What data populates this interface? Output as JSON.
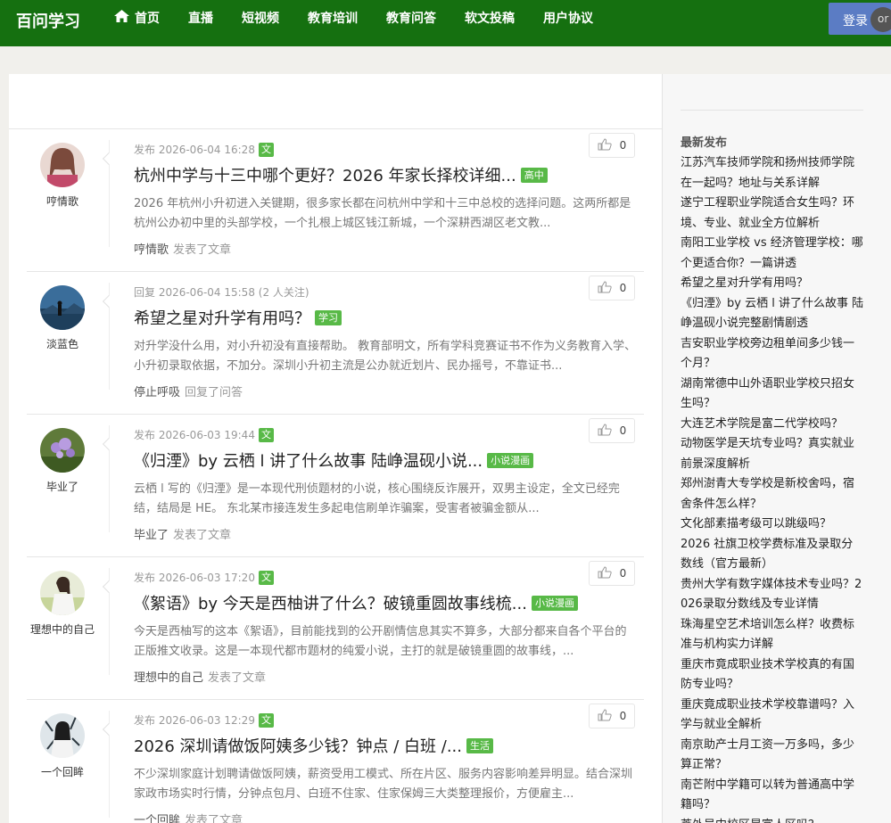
{
  "brand": "百问学习",
  "nav": {
    "items": [
      "首页",
      "直播",
      "短视频",
      "教育培训",
      "教育问答",
      "软文投稿",
      "用户协议"
    ],
    "login_label": "登录",
    "extra_label": "or"
  },
  "feed": [
    {
      "author": "哼情歌",
      "meta_label": "发布 2026-06-04 16:28",
      "type_badge": "文",
      "likes": "0",
      "title": "杭州中学与十三中哪个更好？2026 年家长择校详细...",
      "tag": "高中",
      "excerpt": "2026 年杭州小升初进入关键期，很多家长都在问杭州中学和十三中总校的选择问题。这两所都是杭州公办初中里的头部学校，一个扎根上城区钱江新城，一个深耕西湖区老文教...",
      "action_user": "哼情歌",
      "action_verb": "发表了文章"
    },
    {
      "author": "淡蓝色",
      "meta_label": "回复 2026-06-04 15:58 (2 人关注)",
      "type_badge": "",
      "likes": "0",
      "title": "希望之星对升学有用吗？",
      "tag": "学习",
      "excerpt": "对升学没什么用，对小升初没有直接帮助。 教育部明文，所有学科竞赛证书不作为义务教育入学、小升初录取依据，不加分。深圳小升初主流是公办就近划片、民办摇号，不靠证书...",
      "action_user": "停止呼吸",
      "action_verb": "回复了问答"
    },
    {
      "author": "毕业了",
      "meta_label": "发布 2026-06-03 19:44",
      "type_badge": "文",
      "likes": "0",
      "title": "《归湮》by 云栖 l 讲了什么故事 陆峥温砚小说...",
      "tag": "小说漫画",
      "excerpt": "云栖 l 写的《归湮》是一本现代刑侦题材的小说，核心围绕反诈展开，双男主设定，全文已经完结，结局是 HE。 东北某市接连发生多起电信刷单诈骗案，受害者被骗金额从...",
      "action_user": "毕业了",
      "action_verb": "发表了文章"
    },
    {
      "author": "理想中的自己",
      "meta_label": "发布 2026-06-03 17:20",
      "type_badge": "文",
      "likes": "0",
      "title": "《絮语》by 今天是西柚讲了什么？破镜重圆故事线梳...",
      "tag": "小说漫画",
      "excerpt": "今天是西柚写的这本《絮语》，目前能找到的公开剧情信息其实不算多，大部分都来自各个平台的正版推文收录。这是一本现代都市题材的纯爱小说，主打的就是破镜重圆的故事线，...",
      "action_user": "理想中的自己",
      "action_verb": "发表了文章"
    },
    {
      "author": "一个回眸",
      "meta_label": "发布 2026-06-03 12:29",
      "type_badge": "文",
      "likes": "0",
      "title": "2026 深圳请做饭阿姨多少钱？钟点 / 白班 /...",
      "tag": "生活",
      "excerpt": "不少深圳家庭计划聘请做饭阿姨，薪资受用工模式、所在片区、服务内容影响差异明显。结合深圳家政市场实时行情，分钟点包月、白班不住家、住家保姆三大类整理报价，方便雇主...",
      "action_user": "一个回眸",
      "action_verb": "发表了文章"
    }
  ],
  "sidebar": {
    "title": "最新发布",
    "items": [
      "江苏汽车技师学院和扬州技师学院在一起吗？地址与关系详解",
      "遂宁工程职业学院适合女生吗？环境、专业、就业全方位解析",
      "南阳工业学校 vs 经济管理学校：哪个更适合你？一篇讲透",
      "希望之星对升学有用吗？",
      "《归湮》by 云栖 l 讲了什么故事 陆峥温砚小说完整剧情剧透",
      "吉安职业学校旁边租单间多少钱一个月？",
      "湖南常德中山外语职业学校只招女生吗？",
      "大连艺术学院是富二代学校吗？",
      "动物医学是天坑专业吗？真实就业前景深度解析",
      "郑州澍青大专学校是新校舍吗，宿舍条件怎么样？",
      "文化部素描考级可以跳级吗？",
      "2026 社旗卫校学费标准及录取分数线（官方最新）",
      "贵州大学有数字媒体技术专业吗？2026录取分数线及专业详情",
      "珠海星空艺术培训怎么样？收费标准与机构实力详解",
      "重庆市竟成职业技术学校真的有国防专业吗？",
      "重庆竟成职业技术学校靠谱吗？入学与就业全解析",
      "南京助产士月工资一万多吗，多少算正常？",
      "南芒附中学籍可以转为普通高中学籍吗？",
      "莘外吴中校区是富人区吗？"
    ]
  },
  "colors": {
    "topbar": "#157010",
    "tag_green": "#58b947",
    "login_blue": "#5b7cc4"
  }
}
